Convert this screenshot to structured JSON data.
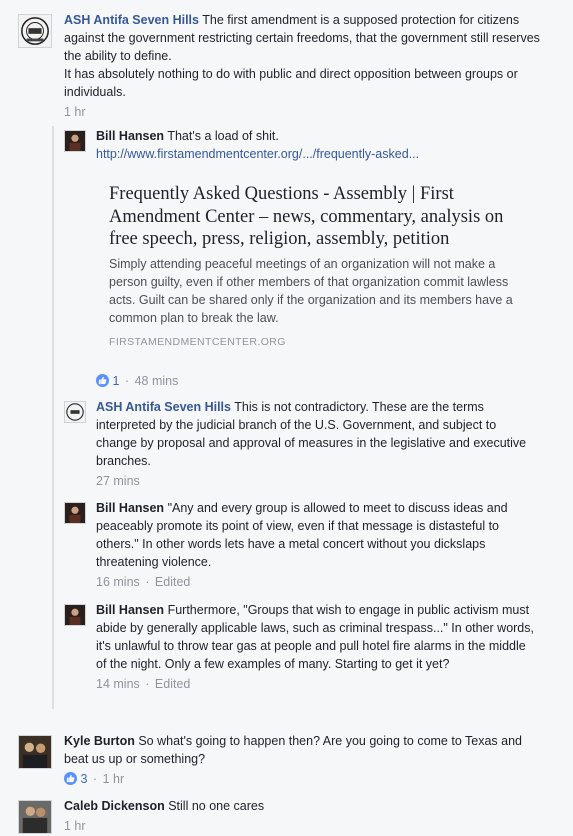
{
  "comments": [
    {
      "author": "ASH Antifa Seven Hills",
      "text": "The first amendment is a supposed protection for citizens against the government restricting certain freedoms, that the government still reserves the ability to define.",
      "text2": "It has absolutely nothing to do with public and direct opposition between groups or individuals.",
      "time": "1 hr"
    },
    {
      "author": "Bill Hansen",
      "text": "That's a load of shit.",
      "link": "http://www.firstamendmentcenter.org/.../frequently-asked...",
      "preview": {
        "title": "Frequently Asked Questions - Assembly | First Amendment Center – news, commentary, analysis on free speech, press, religion, assembly, petition",
        "description": "Simply attending peaceful meetings of an organization will not make a person guilty, even if other members of that organization commit lawless acts. Guilt can be shared only if the organization and its members have a common plan to break the law.",
        "domain": "FIRSTAMENDMENTCENTER.ORG"
      },
      "likes": "1",
      "time": "48 mins"
    },
    {
      "author": "ASH Antifa Seven Hills",
      "text": "This is not contradictory. These are the terms interpreted by the judicial branch of the U.S. Government, and subject to change by proposal and approval of measures in the legislative and executive branches.",
      "time": "27 mins"
    },
    {
      "author": "Bill Hansen",
      "text": "\"Any and every group is allowed to meet to discuss ideas and peaceably promote its point of view, even if that message is distasteful to others.\" In other words lets have a metal concert without you dickslaps threatening violence.",
      "time": "16 mins",
      "edited": "Edited"
    },
    {
      "author": "Bill Hansen",
      "text": "Furthermore, \"Groups that wish to engage in public activism must abide by generally applicable laws, such as criminal trespass...\" In other words, it's unlawful to throw tear gas at people and pull hotel fire alarms in the middle of the night. Only a few examples of many. Starting to get it yet?",
      "time": "14 mins",
      "edited": "Edited"
    },
    {
      "author": "Kyle Burton",
      "text": "So what's going to happen then? Are you going to come to Texas and beat us up or something?",
      "likes": "3",
      "time": "1 hr"
    },
    {
      "author": "Caleb Dickenson",
      "text": "Still no one cares",
      "time": "1 hr"
    }
  ],
  "meta": {
    "separator": "·"
  },
  "colors": {
    "link": "#365899",
    "meta": "#90949c",
    "like": "#5890ff"
  }
}
